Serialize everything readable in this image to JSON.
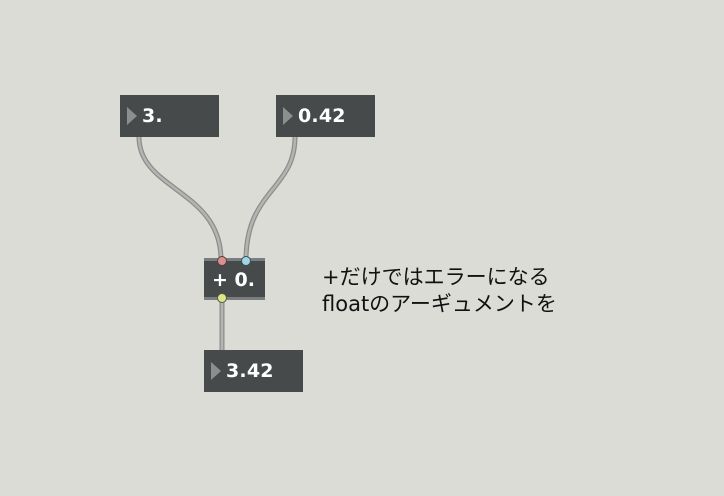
{
  "patch": {
    "number_boxes": [
      {
        "id": "float-in-left",
        "value": "3."
      },
      {
        "id": "float-in-right",
        "value": "0.42"
      },
      {
        "id": "float-out",
        "value": "3.42"
      }
    ],
    "object_box": {
      "text": "+ 0."
    },
    "comment_lines": [
      "+だけではエラーになる",
      "floatのアーギュメントを"
    ],
    "colors": {
      "background": "#dcdcd6",
      "box": "#474a4b",
      "cable": "#a9aaa8",
      "inlet_left": "#d9918f",
      "inlet_right": "#9fd6e6",
      "outlet": "#dde48c"
    }
  }
}
